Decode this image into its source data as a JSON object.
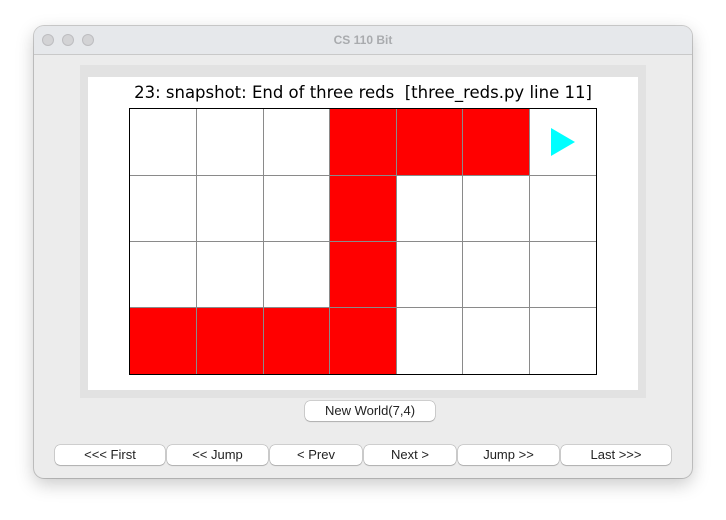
{
  "window": {
    "title": "CS 110 Bit"
  },
  "world": {
    "caption": "23: snapshot: End of three reds  [three_reds.py line 11]",
    "width": 7,
    "height": 4,
    "colors": {
      "red": "#ff0000",
      "empty": "#ffffff",
      "bit": "#00ffff",
      "gridline": "#8a8a8a"
    },
    "cells": [
      [
        "empty",
        "empty",
        "empty",
        "red",
        "red",
        "red",
        "empty"
      ],
      [
        "empty",
        "empty",
        "empty",
        "red",
        "empty",
        "empty",
        "empty"
      ],
      [
        "empty",
        "empty",
        "empty",
        "red",
        "empty",
        "empty",
        "empty"
      ],
      [
        "red",
        "red",
        "red",
        "red",
        "empty",
        "empty",
        "empty"
      ]
    ],
    "bit": {
      "col": 6,
      "row": 0,
      "facing": "right",
      "icon": "bit-triangle-right-icon"
    }
  },
  "new_world_button": {
    "label": "New World(7,4)"
  },
  "nav_buttons": [
    {
      "id": "first",
      "label": "<<< First"
    },
    {
      "id": "jump-back",
      "label": "<< Jump"
    },
    {
      "id": "prev",
      "label": "< Prev"
    },
    {
      "id": "next",
      "label": "Next >"
    },
    {
      "id": "jump-forward",
      "label": "Jump >>"
    },
    {
      "id": "last",
      "label": "Last >>>"
    }
  ]
}
